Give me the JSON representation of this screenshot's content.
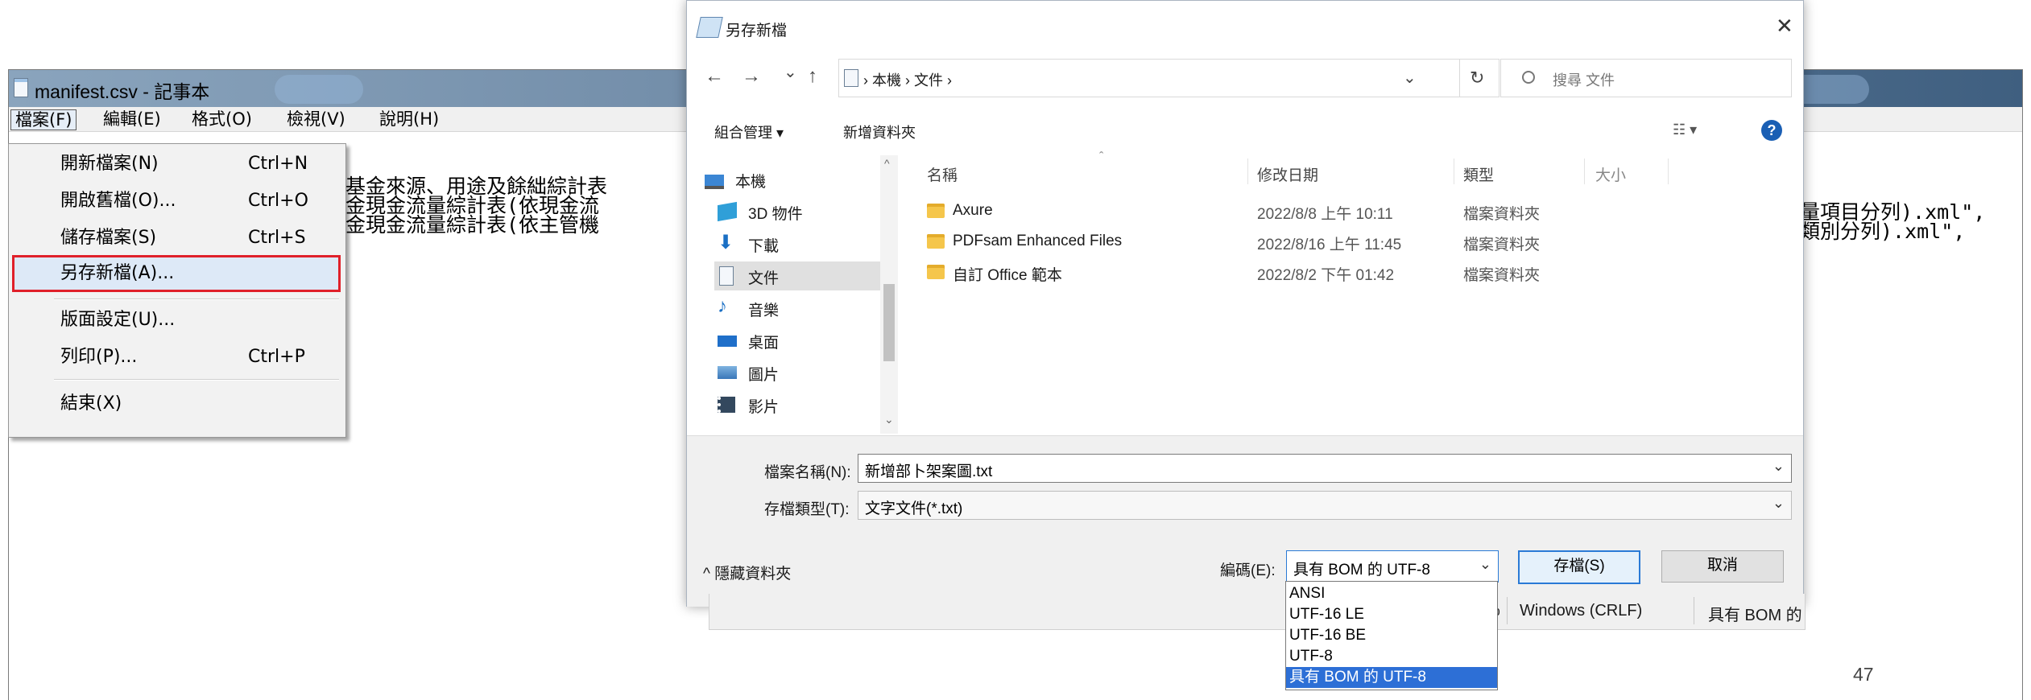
{
  "notepad": {
    "title": "manifest.csv - 記事本",
    "menu": [
      "檔案(F)",
      "編輯(E)",
      "格式(O)",
      "檢視(V)",
      "說明(H)"
    ],
    "lines": [
      "基金來源、用途及餘絀綜計表",
      "金現金流量綜計表(依現金流",
      "金現金流量綜計表(依主管機"
    ],
    "right_lines": [
      "量項目分列).xml\",",
      "類別分列).xml\","
    ]
  },
  "file_menu": {
    "items": [
      {
        "label": "開新檔案(N)",
        "shortcut": "Ctrl+N"
      },
      {
        "label": "開啟舊檔(O)...",
        "shortcut": "Ctrl+O"
      },
      {
        "label": "儲存檔案(S)",
        "shortcut": "Ctrl+S"
      },
      {
        "label": "另存新檔(A)...",
        "shortcut": ""
      },
      {
        "label": "版面設定(U)...",
        "shortcut": ""
      },
      {
        "label": "列印(P)...",
        "shortcut": "Ctrl+P"
      },
      {
        "label": "結束(X)",
        "shortcut": ""
      }
    ]
  },
  "dialog": {
    "title": "另存新檔",
    "close": "✕",
    "nav": {
      "back": "←",
      "forward": "→",
      "recent": "⌄",
      "up": "↑"
    },
    "breadcrumb": [
      "本機",
      "文件"
    ],
    "refresh": "↻",
    "search_placeholder": "搜尋 文件",
    "toolbar": {
      "organize": "組合管理 ▾",
      "new_folder": "新增資料夾",
      "view": "☷ ▾",
      "help": "?"
    },
    "tree": [
      "本機",
      "3D 物件",
      "下載",
      "文件",
      "音樂",
      "桌面",
      "圖片",
      "影片"
    ],
    "columns": [
      "名稱",
      "修改日期",
      "類型",
      "大小"
    ],
    "files": [
      {
        "name": "Axure",
        "date": "2022/8/8 上午 10:11",
        "type": "檔案資料夾"
      },
      {
        "name": "PDFsam Enhanced Files",
        "date": "2022/8/16 上午 11:45",
        "type": "檔案資料夾"
      },
      {
        "name": "自訂 Office 範本",
        "date": "2022/8/2 下午 01:42",
        "type": "檔案資料夾"
      }
    ],
    "filename_label": "檔案名稱(N):",
    "filename_value": "新增部卜架案圖.txt",
    "filetype_label": "存檔類型(T):",
    "filetype_value": "文字文件(*.txt)",
    "hide_folders": "^ 隱藏資料夾",
    "encoding_label": "編碼(E):",
    "encoding_value": "具有 BOM 的 UTF-8",
    "save": "存檔(S)",
    "cancel": "取消",
    "encoding_options": [
      "ANSI",
      "UTF-16 LE",
      "UTF-16 BE",
      "UTF-8",
      "具有 BOM 的 UTF-8"
    ],
    "status_partial": [
      "%",
      "Windows (CRLF)",
      "具有 BOM 的"
    ]
  },
  "page_number": "47"
}
